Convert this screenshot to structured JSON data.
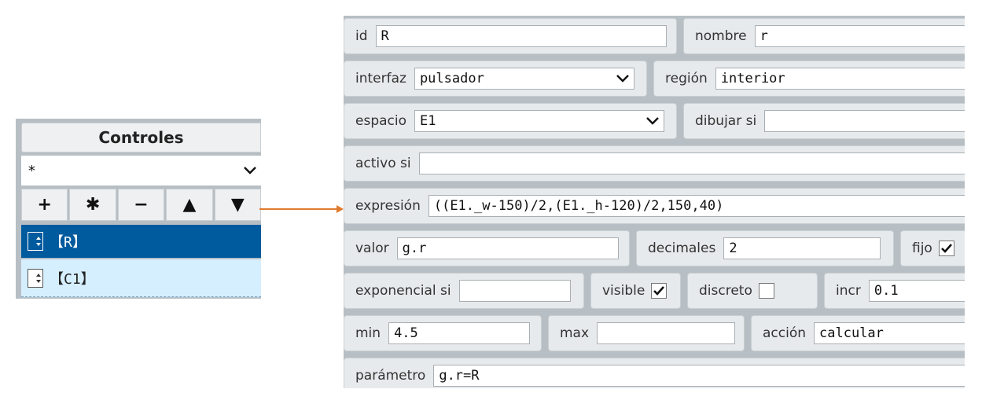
{
  "left_panel": {
    "title": "Controles",
    "filter_value": "*",
    "buttons": [
      {
        "name": "add-button",
        "label": "+"
      },
      {
        "name": "asterisk-button",
        "label": "✱"
      },
      {
        "name": "remove-button",
        "label": "−"
      },
      {
        "name": "move-up-button",
        "label": "▲"
      },
      {
        "name": "move-down-button",
        "label": "▼"
      }
    ],
    "items": [
      {
        "label": "【R】",
        "selected": true
      },
      {
        "label": "【C1】",
        "selected": false
      }
    ]
  },
  "properties": {
    "id": {
      "label": "id",
      "value": "R"
    },
    "nombre": {
      "label": "nombre",
      "value": "r"
    },
    "interfaz": {
      "label": "interfaz",
      "value": "pulsador"
    },
    "region": {
      "label": "región",
      "value": "interior"
    },
    "espacio": {
      "label": "espacio",
      "value": "E1"
    },
    "dibujar_si": {
      "label": "dibujar si",
      "value": ""
    },
    "activo_si": {
      "label": "activo si",
      "value": ""
    },
    "expresion": {
      "label": "expresión",
      "value": "((E1._w-150)/2,(E1._h-120)/2,150,40)"
    },
    "valor": {
      "label": "valor",
      "value": "g.r"
    },
    "decimales": {
      "label": "decimales",
      "value": "2"
    },
    "fijo": {
      "label": "fijo",
      "checked": true
    },
    "exponencial_si": {
      "label": "exponencial si",
      "value": ""
    },
    "visible": {
      "label": "visible",
      "checked": true
    },
    "discreto": {
      "label": "discreto",
      "checked": false
    },
    "incr": {
      "label": "incr",
      "value": "0.1"
    },
    "min": {
      "label": "min",
      "value": "4.5"
    },
    "max": {
      "label": "max",
      "value": ""
    },
    "accion": {
      "label": "acción",
      "value": "calcular"
    },
    "parametro": {
      "label": "parámetro",
      "value": "g.r=R"
    }
  },
  "colors": {
    "selected_item_bg": "#005a9e",
    "item_bg": "#d5efff",
    "connector": "#e07b2e",
    "panel_bg": "#b7bfc4"
  }
}
